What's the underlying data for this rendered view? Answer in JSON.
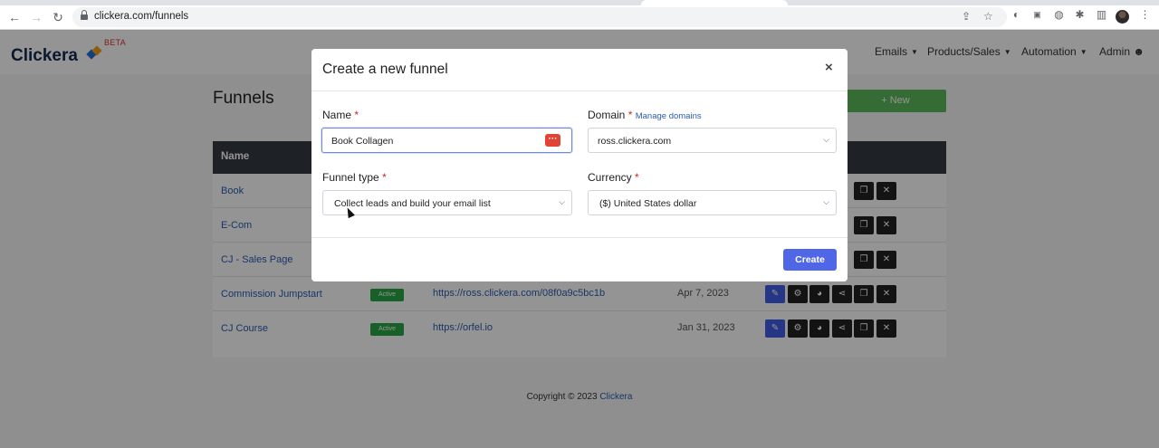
{
  "browser": {
    "url": "clickera.com/funnels"
  },
  "app": {
    "logo": "Clickera",
    "beta": "BETA",
    "menu": [
      {
        "label": "Emails"
      },
      {
        "label": "Products/Sales"
      },
      {
        "label": "Automation"
      },
      {
        "label": "Admin"
      }
    ],
    "page_title": "Funnels",
    "new_button": "+ New",
    "table": {
      "header": "Name",
      "rows": [
        {
          "name": "Book"
        },
        {
          "name": "E-Com"
        },
        {
          "name": "CJ - Sales Page"
        },
        {
          "name": "Commission Jumpstart",
          "status": "Active",
          "url": "https://ross.clickera.com/08f0a9c5bc1b",
          "date": "Apr 7, 2023"
        },
        {
          "name": "CJ Course",
          "status": "Active",
          "url": "https://orfel.io",
          "date": "Jan 31, 2023"
        }
      ]
    },
    "footer": {
      "text": "Copyright © 2023",
      "brand": "Clickera"
    }
  },
  "modal": {
    "title": "Create a new funnel",
    "close": "×",
    "name_label": "Name",
    "name_value": "Book Collagen",
    "domain_label": "Domain",
    "manage_domains": "Manage domains",
    "domain_value": "ross.clickera.com",
    "funnel_type_label": "Funnel type",
    "funnel_type_value": "Collect leads and build your email list",
    "currency_label": "Currency",
    "currency_value": "($) United States dollar",
    "required_mark": "*",
    "create_button": "Create"
  },
  "colors": {
    "primary": "#4f67e6",
    "success": "#5cb85c",
    "table_header": "#343a40",
    "required": "#d0281f"
  }
}
